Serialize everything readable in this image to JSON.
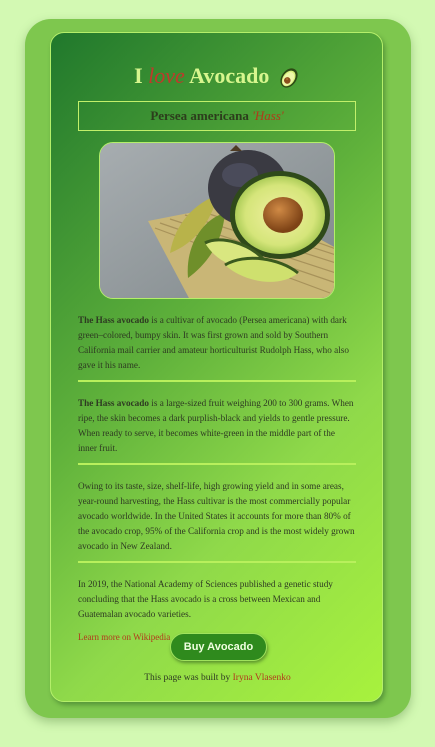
{
  "title": {
    "word_i": "I",
    "word_love": "love",
    "word_avocado": "Avocado"
  },
  "subtitle": {
    "species": "Persea americana",
    "cultivar": "'Hass'"
  },
  "paragraphs": [
    {
      "bold": "The Hass avocado",
      "text": " is a cultivar of avocado (Persea americana) with dark green–colored, bumpy skin. It was first grown and sold by Southern California mail carrier and amateur horticulturist Rudolph Hass, who also gave it his name."
    },
    {
      "bold": "The Hass avocado",
      "text": " is a large-sized fruit weighing 200 to 300 grams. When ripe, the skin becomes a dark purplish-black and yields to gentle pressure. When ready to serve, it becomes white-green in the middle part of the inner fruit."
    },
    {
      "bold": "",
      "text": "Owing to its taste, size, shelf-life, high growing yield and in some areas, year-round harvesting, the Hass cultivar is the most commercially popular avocado worldwide. In the United States it accounts for more than 80% of the avocado crop, 95% of the California crop and is the most widely grown avocado in New Zealand."
    },
    {
      "bold": "",
      "text": "In 2019, the National Academy of Sciences published a genetic study concluding that the Hass avocado is a cross between Mexican and Guatemalan avocado varieties."
    }
  ],
  "wiki_link": "Learn more on Wikipedia",
  "buy_button": "Buy Avocado",
  "footer": {
    "prefix": "This page was built by ",
    "author": "Iryna Vlasenko"
  },
  "icons": {
    "title_icon": "avocado-icon",
    "photo": "avocado-photo"
  },
  "colors": {
    "page_background": "#d3f9b3",
    "card": "#7ec74e",
    "accent_red": "#c0392b",
    "title_green": "#d7f68e",
    "button": "#2f8a1d"
  }
}
